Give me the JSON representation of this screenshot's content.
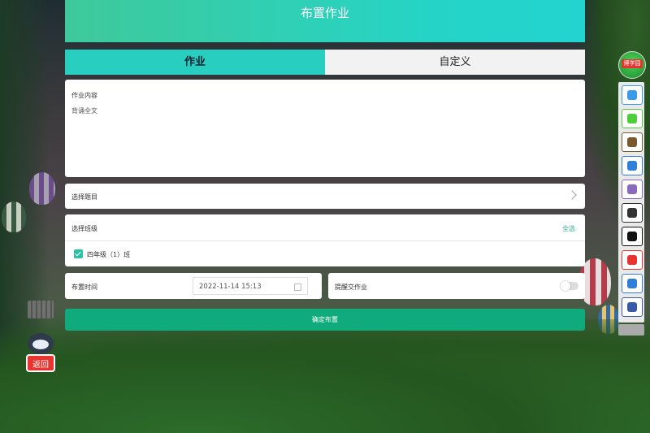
{
  "header": {
    "title": "布置作业"
  },
  "tabs": [
    {
      "label": "作业",
      "active": true
    },
    {
      "label": "自定义",
      "active": false
    }
  ],
  "content": {
    "label": "作业内容",
    "text": "背诵全文"
  },
  "select_topic": {
    "label": "选择题目"
  },
  "select_class": {
    "label": "选择班级",
    "select_all": "全选",
    "classes": [
      {
        "name": "四年级（1）班",
        "checked": true
      }
    ]
  },
  "time": {
    "label": "布置时间",
    "value": "2022-11-14 15:13"
  },
  "remind": {
    "label": "提醒交作业",
    "enabled": false
  },
  "confirm": {
    "label": "确定布置"
  },
  "mascot": {
    "label": "返回"
  },
  "toolbar": {
    "top_label": "博学园",
    "buttons": [
      {
        "name": "cloud-download-icon",
        "color": "#3a9be8"
      },
      {
        "name": "pen-icon",
        "color": "#4ccf3a"
      },
      {
        "name": "blackboard-icon",
        "color": "#7a5a2a"
      },
      {
        "name": "scissors-icon",
        "color": "#2f7fd8"
      },
      {
        "name": "film-icon",
        "color": "#8a6abf"
      },
      {
        "name": "microphone-icon",
        "color": "#333333"
      },
      {
        "name": "record-icon",
        "color": "#111111"
      },
      {
        "name": "bo-logo-icon",
        "color": "#e8342f"
      },
      {
        "name": "keyboard-icon",
        "color": "#2f7fd8"
      },
      {
        "name": "gear-icon",
        "color": "#3a5aa8"
      }
    ]
  }
}
